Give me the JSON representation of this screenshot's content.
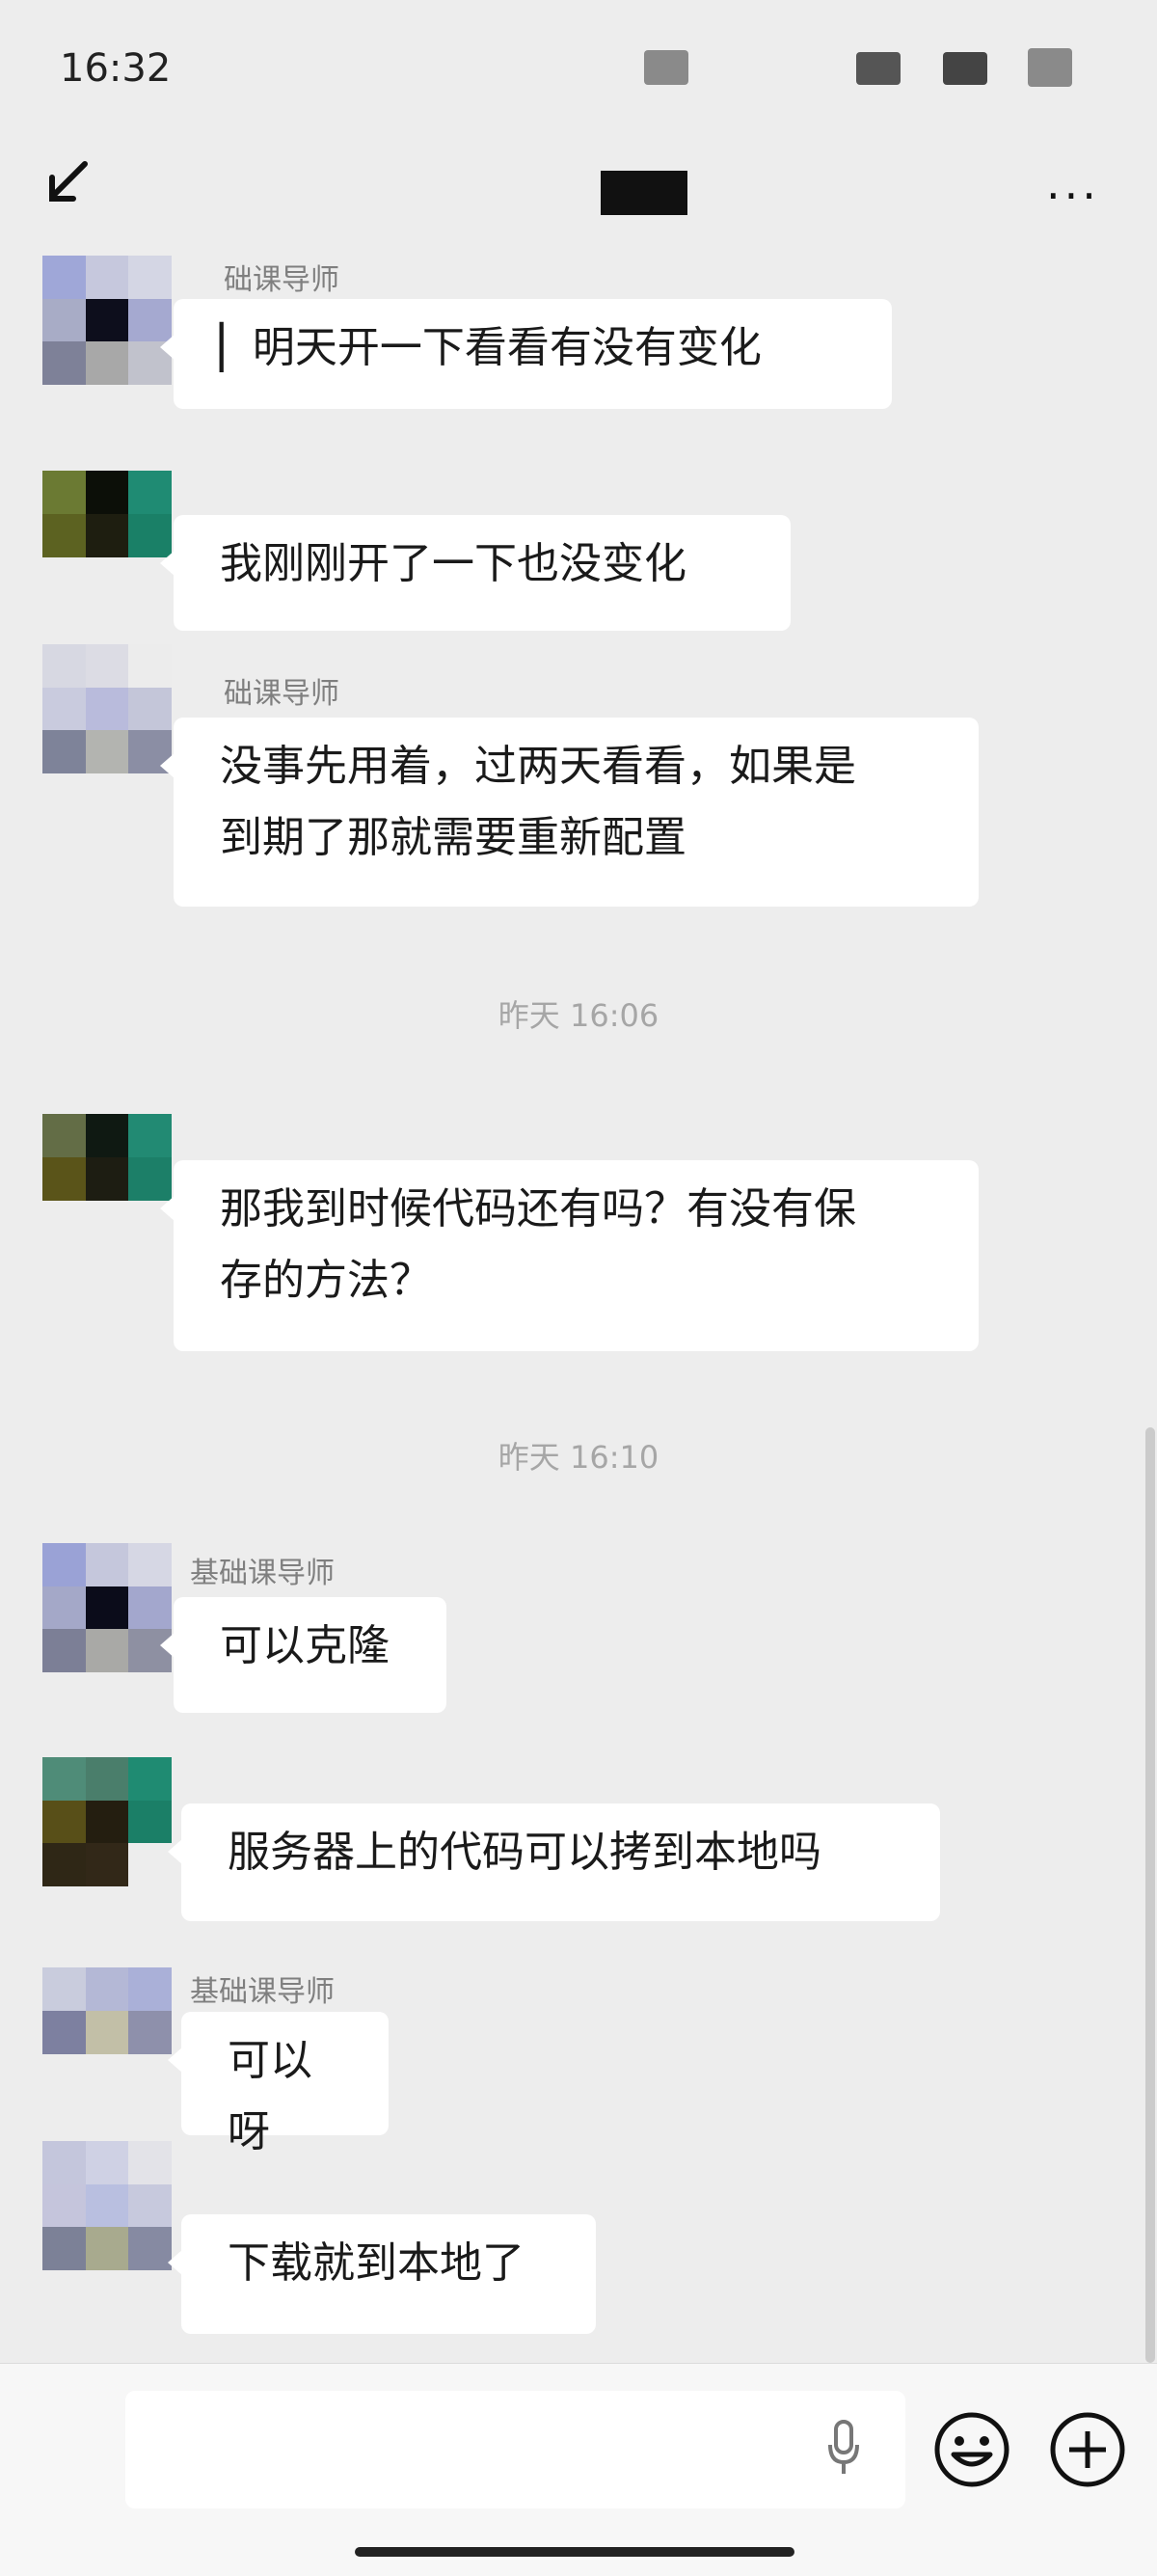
{
  "status_bar": {
    "time": "16:32"
  },
  "nav": {
    "more_label": "···"
  },
  "colors": {
    "background": "#ededed",
    "bubble": "#ffffff",
    "timestamp": "#a6a6a6",
    "sender": "#7f7f7f"
  },
  "messages": [
    {
      "sender": "础课导师",
      "lines": [
        "▏明天开一下看看有没有变化"
      ]
    },
    {
      "sender": "",
      "lines": [
        "我刚刚开了一下也没变化"
      ]
    },
    {
      "sender": "础课导师",
      "lines": [
        "没事先用着，过两天看看，如果是",
        "到期了那就需要重新配置"
      ]
    },
    {
      "sender": "",
      "lines": [
        "那我到时候代码还有吗？有没有保",
        "存的方法？"
      ]
    },
    {
      "sender": "基础课导师",
      "lines": [
        "可以克隆"
      ]
    },
    {
      "sender": "",
      "lines": [
        "服务器上的代码可以拷到本地吗"
      ]
    },
    {
      "sender": "基础课导师",
      "lines": [
        "可以呀"
      ]
    },
    {
      "sender": "",
      "lines": [
        "下载就到本地了"
      ]
    }
  ],
  "timestamps": [
    "昨天 16:06",
    "昨天 16:10"
  ],
  "input": {
    "value": "",
    "icons": [
      "mic-icon",
      "emoji-icon",
      "plus-icon"
    ]
  }
}
